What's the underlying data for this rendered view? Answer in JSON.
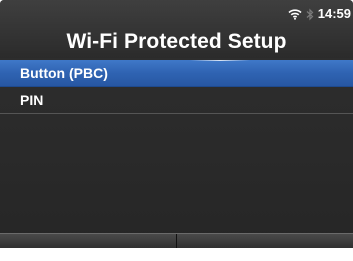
{
  "header": {
    "title": "Wi-Fi Protected Setup"
  },
  "status_bar": {
    "time": "14:59",
    "icons": [
      "wifi-icon",
      "bluetooth-icon"
    ]
  },
  "menu": {
    "items": [
      {
        "label": "Button (PBC)",
        "selected": true
      },
      {
        "label": "PIN",
        "selected": false
      }
    ]
  },
  "softkeys": {
    "left": "",
    "right": ""
  },
  "colors": {
    "selection": "#2f63b2",
    "background": "#2a2a2a",
    "text": "#ffffff"
  }
}
